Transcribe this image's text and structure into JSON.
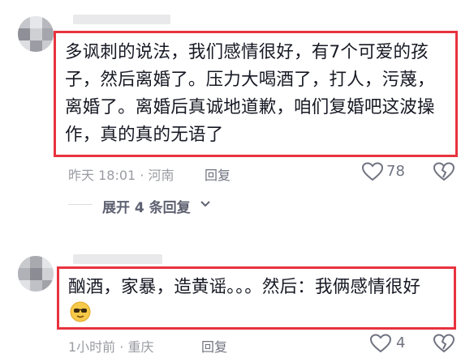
{
  "comments": [
    {
      "text_lines": [
        "多讽刺的说法，我们感情很好，有7个可爱的孩",
        "子，然后离婚了。压力大喝酒了，打人，污蔑，",
        "离婚了。离婚后真诚地道歉，咱们复婚吧这波操",
        "作，真的真的无语了"
      ],
      "time": "昨天 18:01 · 河南",
      "reply_label": "回复",
      "likes": "78",
      "expand_label": "展开 4 条回复"
    },
    {
      "text": "酗酒，家暴，造黄谣。。。然后：我俩感情很好",
      "emoji": "sunglasses-emoji",
      "time": "1小时前 · 重庆",
      "reply_label": "回复",
      "likes": "4"
    }
  ],
  "colors": {
    "highlight_border": "#e8333f",
    "meta_text": "#9a9ca3",
    "icon": "#707380"
  }
}
